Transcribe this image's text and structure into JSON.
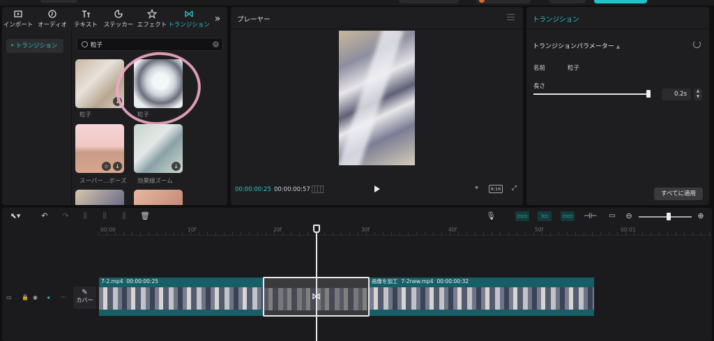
{
  "media": {
    "tabs": [
      {
        "label": "インポート",
        "icon": "import-icon"
      },
      {
        "label": "オーディオ",
        "icon": "audio-icon"
      },
      {
        "label": "テキスト",
        "icon": "text-icon"
      },
      {
        "label": "ステッカー",
        "icon": "sticker-icon"
      },
      {
        "label": "エフェクト",
        "icon": "effect-icon"
      },
      {
        "label": "トランジション",
        "icon": "transition-icon"
      }
    ],
    "more": "»",
    "active_tab": "トランジション",
    "sidebar_item": "• トランジション",
    "search_value": "粒子",
    "items": [
      {
        "label": "粒子"
      },
      {
        "label": "粒子"
      },
      {
        "label": "スーパー…ボーズ"
      },
      {
        "label": "効果線ズーム"
      }
    ],
    "accent": "#2fc7cc",
    "highlight_color": "#f3a8c6"
  },
  "player": {
    "title": "プレーヤー",
    "current_time": "00:00:00:25",
    "duration": "00:00:00:57",
    "ratio_label": "9:16"
  },
  "props": {
    "header": "トランジション",
    "section_title": "トランジションパラメーター",
    "name_key": "名前",
    "name_value": "粒子",
    "length_key": "長さ",
    "length_value": "0.2s",
    "apply_all": "すべてに適用"
  },
  "timeline": {
    "ruler": [
      "00:00",
      "10f",
      "20f",
      "30f",
      "40f",
      "50f",
      "00:01"
    ],
    "cover_label": "カバー",
    "clip1": {
      "name": "7-2.mp4",
      "duration": "00:00:00:25"
    },
    "clip2": {
      "tag": "画像を加工",
      "name": "7-2new.mp4",
      "duration": "00:00:00:32"
    }
  }
}
